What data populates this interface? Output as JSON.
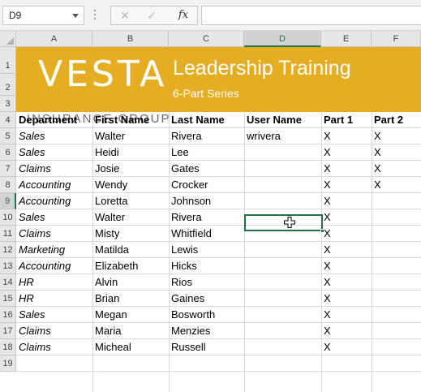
{
  "formula_bar": {
    "name_box": "D9",
    "cancel_icon": "✕",
    "enter_icon": "✓",
    "fx_label": "fx",
    "formula": ""
  },
  "columns": [
    "A",
    "B",
    "C",
    "D",
    "E",
    "F"
  ],
  "rows": [
    "1",
    "2",
    "3",
    "4",
    "5",
    "6",
    "7",
    "8",
    "9",
    "10",
    "11",
    "12",
    "13",
    "14",
    "15",
    "16",
    "17",
    "18",
    "19"
  ],
  "selected_cell": "D9",
  "banner": {
    "logo": "VESTA",
    "title": "Leadership Training",
    "subtitle": "6-Part Series",
    "company": "INSURANCE GROUP",
    "color": "#e5ad21"
  },
  "table": {
    "headers": [
      "Department",
      "First Name",
      "Last Name",
      "User Name",
      "Part 1",
      "Part 2"
    ],
    "rows": [
      [
        "Sales",
        "Walter",
        "Rivera",
        "wrivera",
        "X",
        "X"
      ],
      [
        "Sales",
        "Heidi",
        "Lee",
        "",
        "X",
        "X"
      ],
      [
        "Claims",
        "Josie",
        "Gates",
        "",
        "X",
        "X"
      ],
      [
        "Accounting",
        "Wendy",
        "Crocker",
        "",
        "X",
        "X"
      ],
      [
        "Accounting",
        "Loretta",
        "Johnson",
        "",
        "X",
        ""
      ],
      [
        "Sales",
        "Walter",
        "Rivera",
        "",
        "X",
        ""
      ],
      [
        "Claims",
        "Misty",
        "Whitfield",
        "",
        "X",
        ""
      ],
      [
        "Marketing",
        "Matilda",
        "Lewis",
        "",
        "X",
        ""
      ],
      [
        "Accounting",
        "Elizabeth",
        "Hicks",
        "",
        "X",
        ""
      ],
      [
        "HR",
        "Alvin",
        "Rios",
        "",
        "X",
        ""
      ],
      [
        "HR",
        "Brian",
        "Gaines",
        "",
        "X",
        ""
      ],
      [
        "Sales",
        "Megan",
        "Bosworth",
        "",
        "X",
        ""
      ],
      [
        "Claims",
        "Maria",
        "Menzies",
        "",
        "X",
        ""
      ],
      [
        "Claims",
        "Micheal",
        "Russell",
        "",
        "X",
        ""
      ]
    ]
  },
  "accent_color": "#217346"
}
